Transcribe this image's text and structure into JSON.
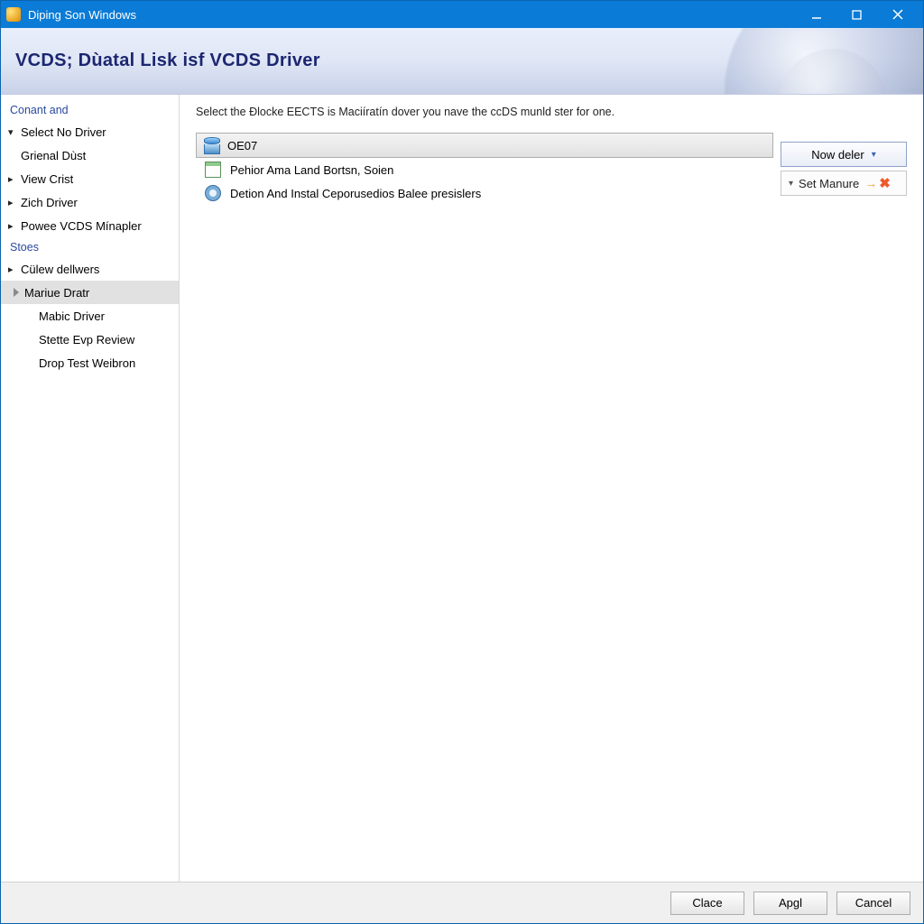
{
  "titlebar": {
    "title": "Diping Son Windows"
  },
  "header": {
    "title": "VCDS; Dùatal Lisk isf VCDS Driver"
  },
  "sidebar": {
    "section1": "Conant and",
    "items1": [
      {
        "label": "Select No Driver",
        "arrow": "down"
      },
      {
        "label": "Grienal Dùst",
        "arrow": "none"
      },
      {
        "label": "View Crist",
        "arrow": "right"
      },
      {
        "label": "Zich Driver",
        "arrow": "right"
      },
      {
        "label": "Powee VCDS Mínapler",
        "arrow": "right"
      }
    ],
    "section2": "Stoes",
    "items2": [
      {
        "label": "Cülew dellwers",
        "arrow": "right"
      },
      {
        "label": "Mariue Dratr",
        "arrow": "sel",
        "selected": true
      },
      {
        "label": "Mabic Driver",
        "arrow": "none"
      },
      {
        "label": "Stette Evp Review",
        "arrow": "none"
      },
      {
        "label": "Drop Test Weibron",
        "arrow": "none"
      }
    ]
  },
  "main": {
    "instruction": "Select the Đlocke EECTS is Maciíratín dover you nave the ccDS munld ster for one.",
    "rows": [
      {
        "label": "OE07"
      },
      {
        "label": "Pehior Ama Land Bortsn, Soien"
      },
      {
        "label": "Detion And Instal Ceporusedios Balee presislers"
      }
    ],
    "dropdown": {
      "label": "Now deler",
      "sub": "Set Manure"
    }
  },
  "footer": {
    "buttons": {
      "clace": "Clace",
      "apply": "Apgl",
      "cancel": "Cancel"
    }
  }
}
